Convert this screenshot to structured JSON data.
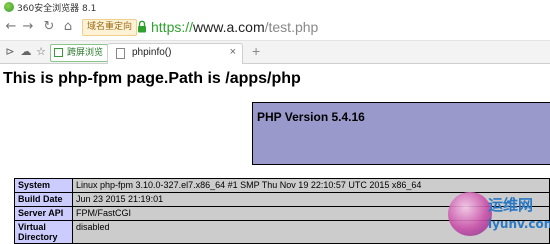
{
  "titlebar": {
    "title": "360安全浏览器 8.1"
  },
  "addressbar": {
    "back_icon": "←",
    "forward_icon": "→",
    "refresh_icon": "↻",
    "home_icon": "⌂",
    "redirect_label": "域名重定向",
    "url_scheme": "https://",
    "url_host": "www.a.com",
    "url_path": "/test.php"
  },
  "tabbar": {
    "sidebar_toggle_icon": "⊳",
    "cloud_icon": "☁",
    "bookmark_icon": "☆",
    "split_screen_label": "跨屏浏览",
    "tab_label": "phpinfo()",
    "tab_close": "×",
    "new_tab": "+"
  },
  "page": {
    "heading": "This is php-fpm page.Path is /apps/php",
    "php_version": "PHP Version 5.4.16",
    "rows": [
      {
        "key": "System",
        "value": "Linux php-fpm 3.10.0-327.el7.x86_64 #1 SMP Thu Nov 19 22:10:57 UTC 2015 x86_64"
      },
      {
        "key": "Build Date",
        "value": "Jun 23 2015 21:19:01"
      },
      {
        "key": "Server API",
        "value": "FPM/FastCGI"
      },
      {
        "key": "Virtual Directory",
        "value": "disabled"
      }
    ]
  },
  "watermark": {
    "cn": "运维网",
    "en": "iyunv.com"
  },
  "colors": {
    "php_header_bg": "#9999cc",
    "table_key_bg": "#ccccff",
    "table_val_bg": "#cccccc",
    "secure_green": "#2ea12e"
  }
}
